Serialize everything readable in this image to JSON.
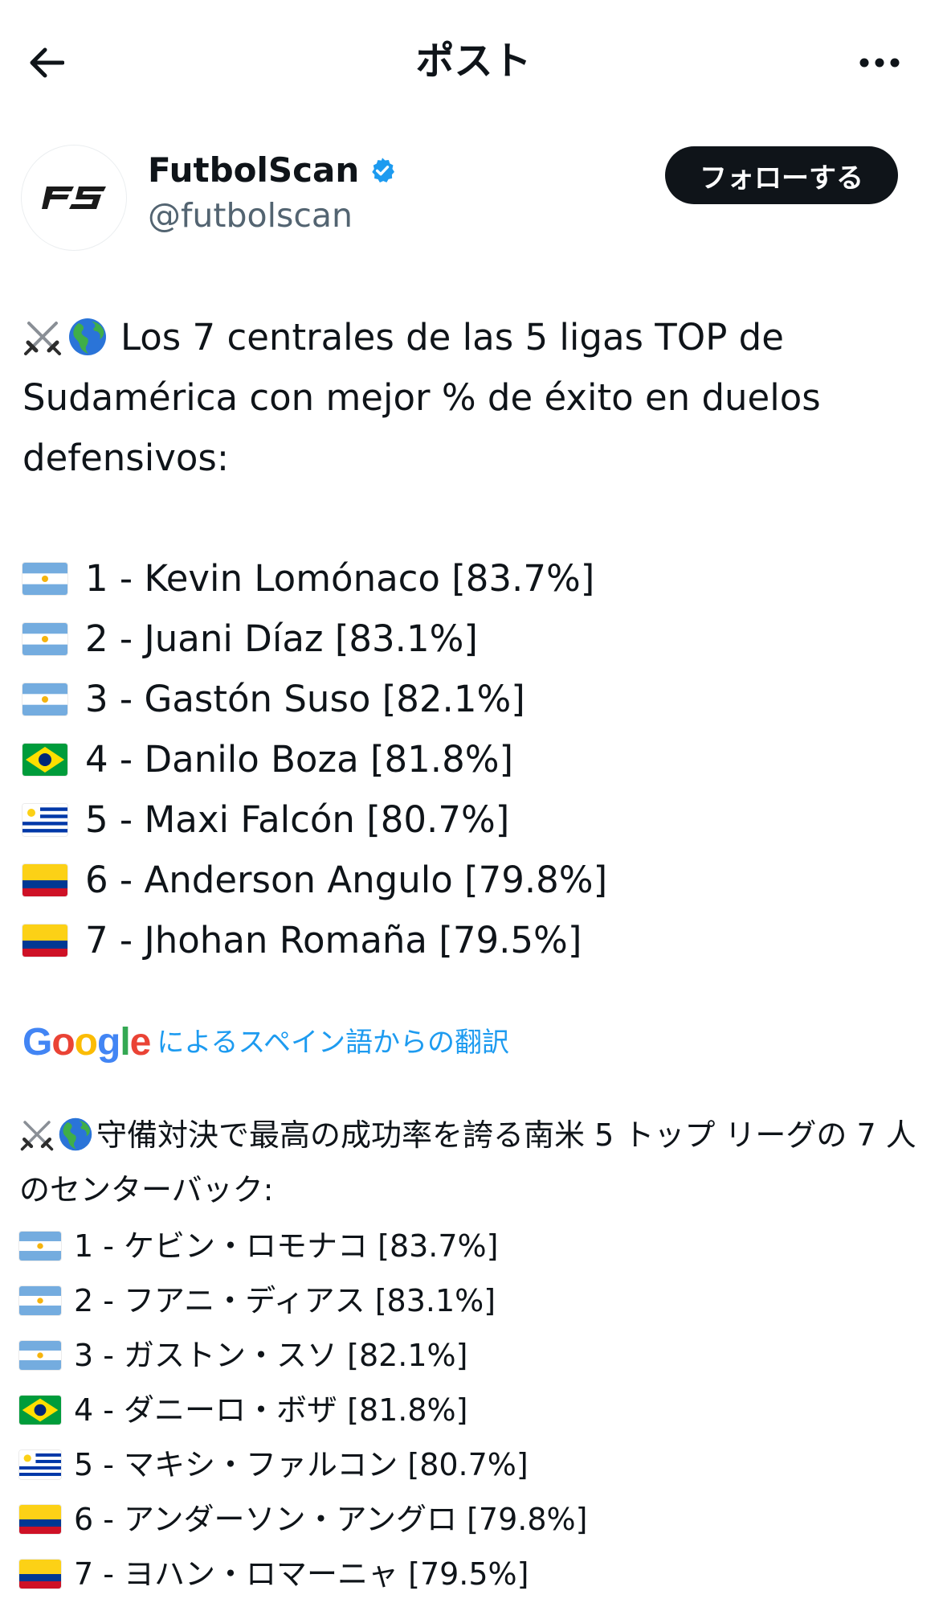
{
  "header": {
    "title": "ポスト"
  },
  "author": {
    "display_name": "FutbolScan",
    "handle": "@futbolscan",
    "follow_label": "フォローする"
  },
  "tweet": {
    "intro": "Los 7 centrales de las 5 ligas TOP de Sudamérica con mejor % de éxito en duelos defensivos:",
    "ranking": [
      {
        "flag": "argentina",
        "text": "1 - Kevin Lomónaco [83.7%]"
      },
      {
        "flag": "argentina",
        "text": "2 - Juani Díaz [83.1%]"
      },
      {
        "flag": "argentina",
        "text": "3 - Gastón Suso [82.1%]"
      },
      {
        "flag": "brazil",
        "text": "4 - Danilo Boza [81.8%]"
      },
      {
        "flag": "uruguay",
        "text": "5 - Maxi Falcón [80.7%]"
      },
      {
        "flag": "colombia",
        "text": "6 - Anderson Angulo [79.8%]"
      },
      {
        "flag": "colombia",
        "text": "7 - Jhohan Romaña [79.5%]"
      }
    ]
  },
  "translation": {
    "google_label": "Google",
    "label": "によるスペイン語からの翻訳",
    "intro": "守備対決で最高の成功率を誇る南米 5 トップ リーグの 7 人のセンターバック:",
    "ranking": [
      {
        "flag": "argentina",
        "text": "1 - ケビン・ロモナコ [83.7%]"
      },
      {
        "flag": "argentina",
        "text": "2 - フアニ・ディアス [83.1%]"
      },
      {
        "flag": "argentina",
        "text": "3 - ガストン・スソ [82.1%]"
      },
      {
        "flag": "brazil",
        "text": "4 - ダニーロ・ボザ [81.8%]"
      },
      {
        "flag": "uruguay",
        "text": "5 - マキシ・ファルコン [80.7%]"
      },
      {
        "flag": "colombia",
        "text": "6 - アンダーソン・アングロ [79.8%]"
      },
      {
        "flag": "colombia",
        "text": "7 - ヨハン・ロマーニャ [79.5%]"
      }
    ]
  },
  "icons": {
    "back": "arrow-left-icon",
    "more": "more-horizontal-icon",
    "verified": "verified-badge-icon",
    "intro_emoji": [
      "crossed-swords-icon",
      "globe-americas-icon"
    ]
  },
  "colors": {
    "accent": "#1d9bf0",
    "text": "#0f1419",
    "muted": "#536471",
    "button_bg": "#0f1419"
  }
}
